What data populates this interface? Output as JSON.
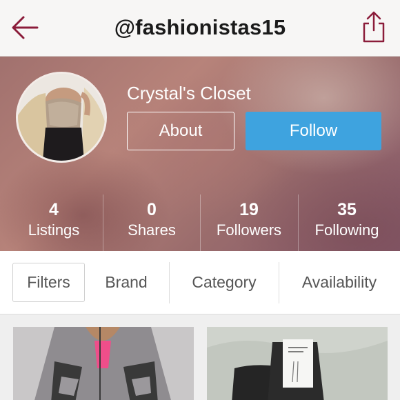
{
  "topbar": {
    "title": "@fashionistas15",
    "back_icon": "arrow-left-icon",
    "share_icon": "share-icon",
    "accent_color": "#8b1c3a"
  },
  "profile": {
    "name": "Crystal's Closet",
    "about_label": "About",
    "follow_label": "Follow",
    "follow_color": "#3ea3df"
  },
  "stats": [
    {
      "value": "4",
      "label": "Listings"
    },
    {
      "value": "0",
      "label": "Shares"
    },
    {
      "value": "19",
      "label": "Followers"
    },
    {
      "value": "35",
      "label": "Following"
    }
  ],
  "filters": {
    "primary": "Filters",
    "items": [
      "Brand",
      "Category",
      "Availability"
    ]
  }
}
